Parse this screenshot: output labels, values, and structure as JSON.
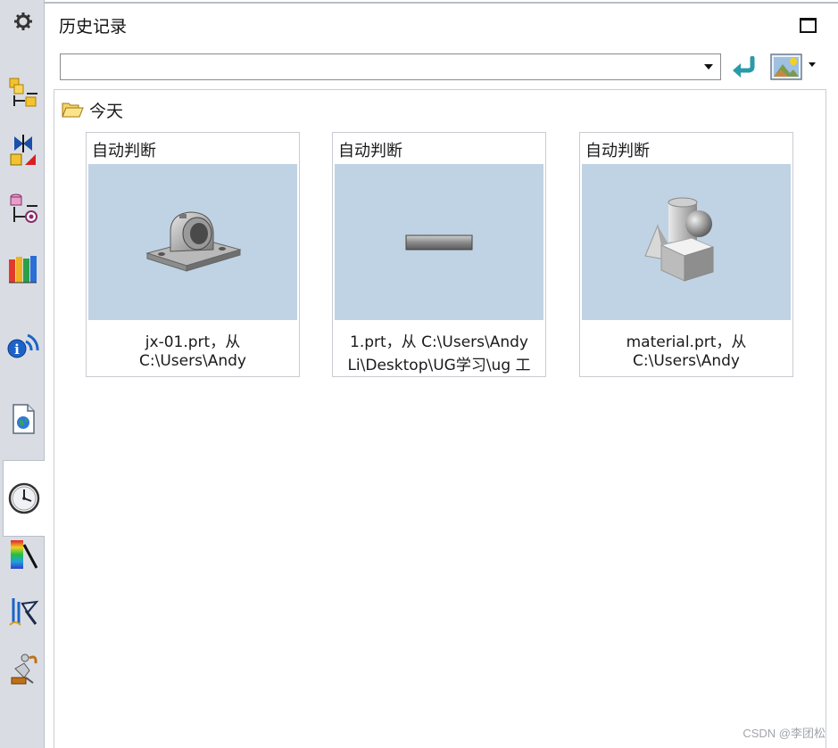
{
  "panel": {
    "title": "历史记录"
  },
  "address": {
    "value": ""
  },
  "group": {
    "label": "今天"
  },
  "cards": [
    {
      "title": "自动判断",
      "line1": "jx-01.prt，从",
      "line2": "C:\\Users\\Andy",
      "thumbnail": "pillow-block-model"
    },
    {
      "title": "自动判断",
      "line1": "1.prt，从 C:\\Users\\Andy",
      "line2": "Li\\Desktop\\UG学习\\ug 工",
      "thumbnail": "flat-bar-model"
    },
    {
      "title": "自动判断",
      "line1": "material.prt，从",
      "line2": "C:\\Users\\Andy",
      "thumbnail": "primitive-shapes-model"
    }
  ],
  "rail_icons": [
    "gear-icon",
    "assembly-navigator-icon",
    "constraint-navigator-icon",
    "part-navigator-icon",
    "reuse-library-icon",
    "hd3d-tools-icon",
    "web-browser-icon",
    "history-icon",
    "visualization-icon",
    "process-studio-icon",
    "roles-icon"
  ],
  "watermark": "CSDN @李团松",
  "colors": {
    "rail_bg": "#d9dde3",
    "thumbnail_bg": "#c0d3e4",
    "accent_teal": "#2a9aa8"
  }
}
